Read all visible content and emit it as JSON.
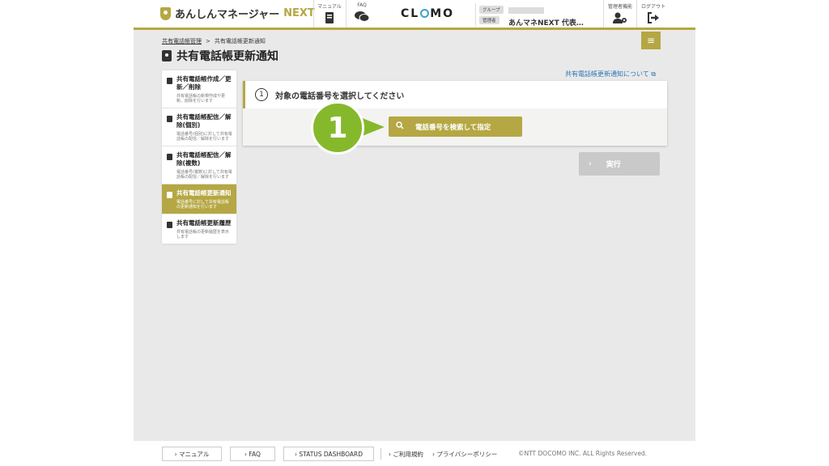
{
  "header": {
    "logo_text": "あんしんマネージャー",
    "logo_next": "NEXT",
    "manual_label": "マニュアル",
    "faq_label": "FAQ",
    "clomo_pre": "CL",
    "clomo_post": "MO",
    "group_tag": "グループ",
    "admin_tag": "管理者",
    "admin_name": "あんマネNEXT 代表…",
    "admin_func_label": "管理者機能",
    "logout_label": "ログアウト"
  },
  "breadcrumb": {
    "parent": "共有電話帳管理",
    "separator": ">",
    "current": "共有電話帳更新通知"
  },
  "page": {
    "title": "共有電話帳更新通知",
    "help_link": "共有電話帳更新通知について"
  },
  "sidebar": {
    "items": [
      {
        "title": "共有電話帳作成／更新／削除",
        "desc": "共有電話帳の新規作成や更新、削除を行います"
      },
      {
        "title": "共有電話帳配信／解除(個別)",
        "desc": "電話番号(個別)に対して共有電話帳の配信／解除を行います"
      },
      {
        "title": "共有電話帳配信／解除(複数)",
        "desc": "電話番号(複数)に対して共有電話帳の配信／解除を行います"
      },
      {
        "title": "共有電話帳更新通知",
        "desc": "電話番号に対して共有電話帳の更新通知を行います"
      },
      {
        "title": "共有電話帳更新履歴",
        "desc": "共有電話帳の更新履歴を表示します"
      }
    ]
  },
  "step": {
    "number": "1",
    "label": "対象の電話番号を選択してください",
    "search_button": "電話番号を検索して指定"
  },
  "callout_number": "1",
  "execute_button": "実行",
  "footer": {
    "manual": "マニュアル",
    "faq": "FAQ",
    "status": "STATUS DASHBOARD",
    "terms": "ご利用規約",
    "privacy": "プライバシーポリシー",
    "copyright": "©NTT DOCOMO INC. ALL Rights Reserved."
  },
  "colors": {
    "accent": "#b5a743",
    "callout": "#86b82c",
    "link": "#2b77b8",
    "disabled": "#c9c9c9"
  }
}
